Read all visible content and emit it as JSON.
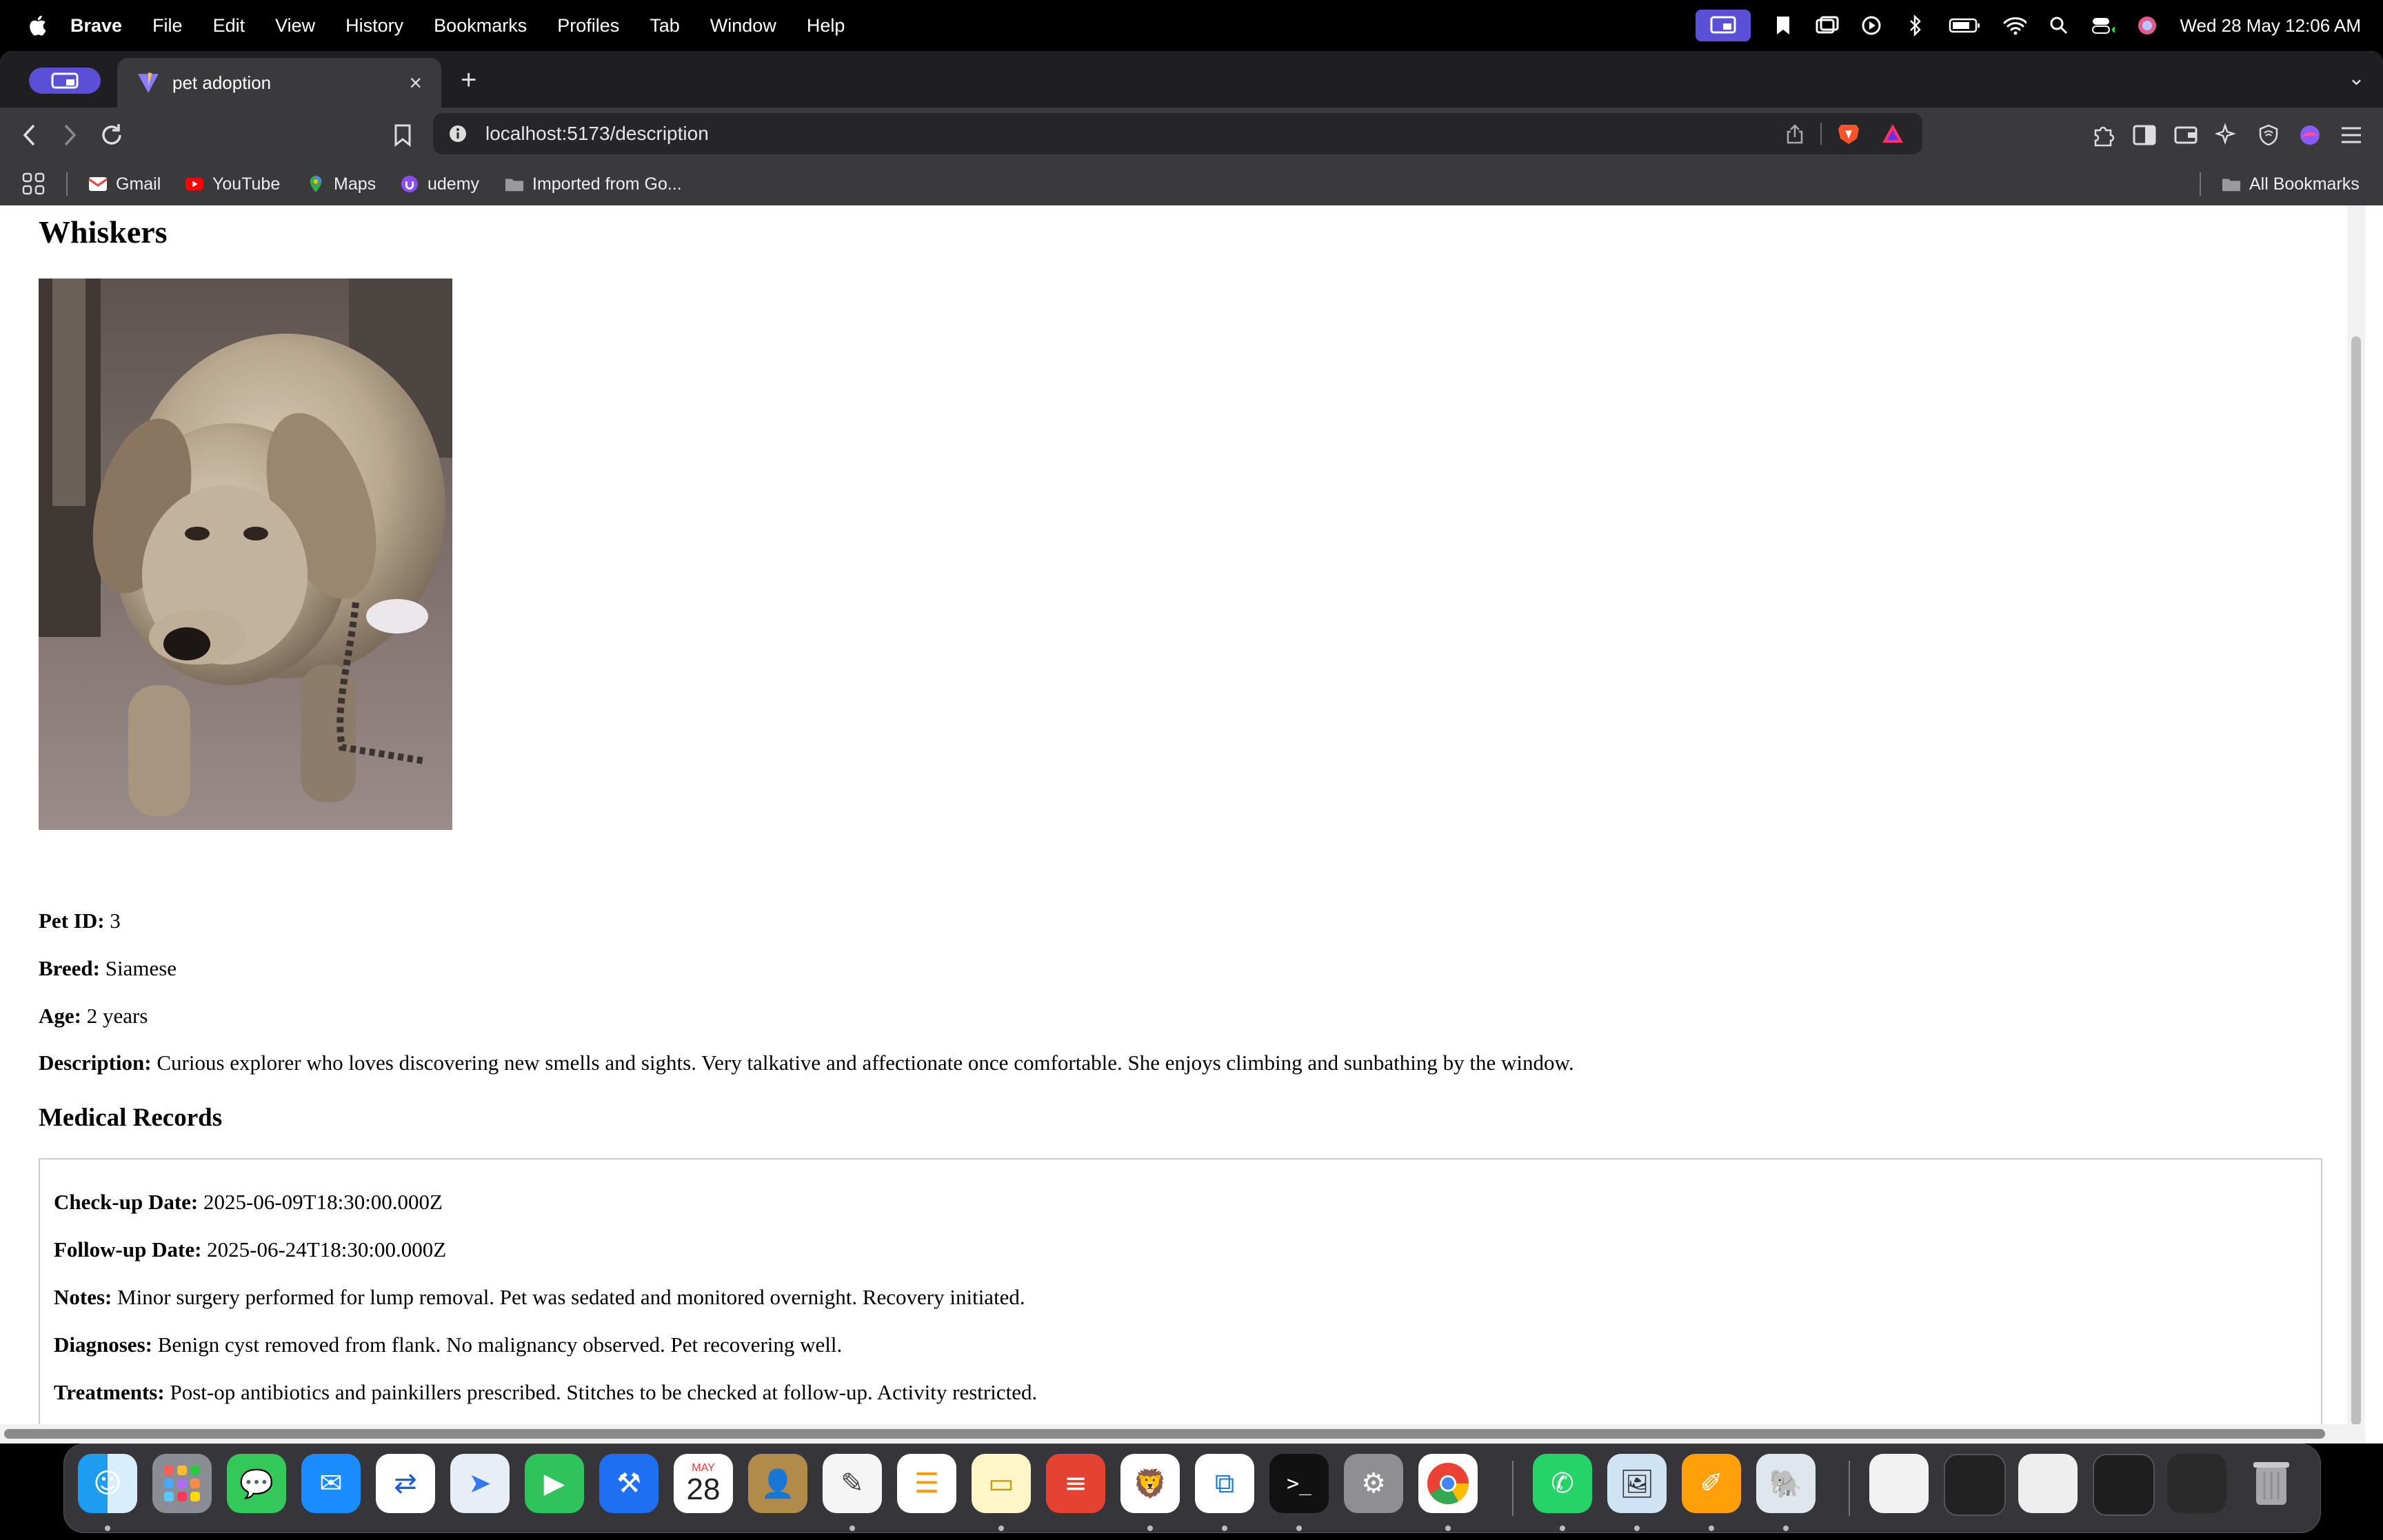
{
  "menubar": {
    "app_name": "Brave",
    "items": [
      "File",
      "Edit",
      "View",
      "History",
      "Bookmarks",
      "Profiles",
      "Tab",
      "Window",
      "Help"
    ],
    "clock": "Wed 28 May  12:06 AM"
  },
  "browser": {
    "tab_title": "pet adoption",
    "new_tab": "+",
    "close_tab": "×",
    "url": "localhost:5173/description",
    "bookmarks": [
      "Gmail",
      "YouTube",
      "Maps",
      "udemy",
      "Imported from Go..."
    ],
    "all_bookmarks": "All Bookmarks"
  },
  "pet": {
    "name": "Whiskers",
    "photo_icon": "puppy-photo",
    "id_label": "Pet ID:",
    "id": "3",
    "breed_label": "Breed:",
    "breed": "Siamese",
    "age_label": "Age:",
    "age": "2 years",
    "description_label": "Description:",
    "description": "Curious explorer who loves discovering new smells and sights. Very talkative and affectionate once comfortable. She enjoys climbing and sunbathing by the window."
  },
  "medical": {
    "heading": "Medical Records",
    "checkup_label": "Check-up Date:",
    "checkup": "2025-06-09T18:30:00.000Z",
    "followup_label": "Follow-up Date:",
    "followup": "2025-06-24T18:30:00.000Z",
    "notes_label": "Notes:",
    "notes": "Minor surgery performed for lump removal. Pet was sedated and monitored overnight. Recovery initiated.",
    "diagnoses_label": "Diagnoses:",
    "diagnoses": "Benign cyst removed from flank. No malignancy observed. Pet recovering well.",
    "treatments_label": "Treatments:",
    "treatments": "Post-op antibiotics and painkillers prescribed. Stitches to be checked at follow-up. Activity restricted."
  },
  "dock": {
    "calendar_month": "MAY",
    "calendar_day": "28"
  }
}
